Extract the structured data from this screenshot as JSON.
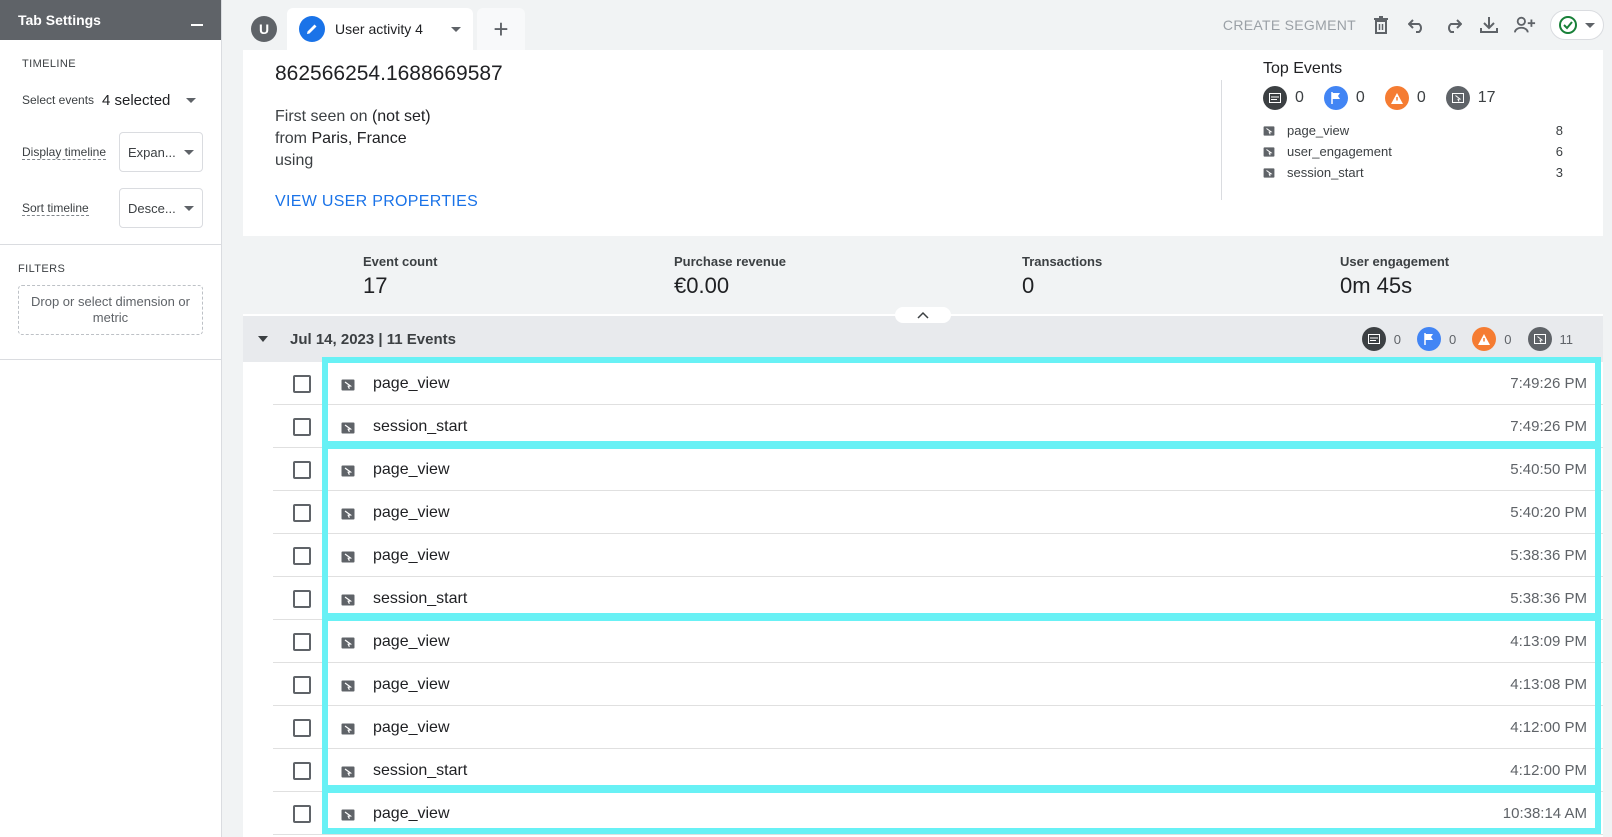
{
  "left_panel": {
    "title": "Tab Settings",
    "timeline_section": "TIMELINE",
    "select_events_label": "Select events",
    "select_events_value": "4 selected",
    "display_timeline_label": "Display timeline",
    "display_timeline_value": "Expan...",
    "sort_timeline_label": "Sort timeline",
    "sort_timeline_value": "Desce...",
    "filters_section": "FILTERS",
    "filters_drop_text": "Drop or select dimension or metric"
  },
  "topbar": {
    "avatar_letter": "U",
    "tab_label": "User activity 4",
    "create_segment": "CREATE SEGMENT"
  },
  "user": {
    "id": "862566254.1688669587",
    "first_seen_prefix": "First seen on",
    "first_seen_value": "(not set)",
    "from_prefix": "from",
    "from_value": "Paris, France",
    "using_text": "using",
    "view_properties": "VIEW USER PROPERTIES"
  },
  "top_events": {
    "title": "Top Events",
    "counts": {
      "dark": "0",
      "blue": "0",
      "orange": "0",
      "grey": "17"
    },
    "items": [
      {
        "name": "page_view",
        "value": "8"
      },
      {
        "name": "user_engagement",
        "value": "6"
      },
      {
        "name": "session_start",
        "value": "3"
      }
    ]
  },
  "metrics": [
    {
      "label": "Event count",
      "value": "17"
    },
    {
      "label": "Purchase revenue",
      "value": "€0.00"
    },
    {
      "label": "Transactions",
      "value": "0"
    },
    {
      "label": "User engagement",
      "value": "0m 45s"
    }
  ],
  "date_group": {
    "label": "Jul 14, 2023 | 11 Events",
    "counts": {
      "dark": "0",
      "blue": "0",
      "orange": "0",
      "grey": "11"
    }
  },
  "events": [
    {
      "name": "page_view",
      "time": "7:49:26 PM"
    },
    {
      "name": "session_start",
      "time": "7:49:26 PM"
    },
    {
      "name": "page_view",
      "time": "5:40:50 PM"
    },
    {
      "name": "page_view",
      "time": "5:40:20 PM"
    },
    {
      "name": "page_view",
      "time": "5:38:36 PM"
    },
    {
      "name": "session_start",
      "time": "5:38:36 PM"
    },
    {
      "name": "page_view",
      "time": "4:13:09 PM"
    },
    {
      "name": "page_view",
      "time": "4:13:08 PM"
    },
    {
      "name": "page_view",
      "time": "4:12:00 PM"
    },
    {
      "name": "session_start",
      "time": "4:12:00 PM"
    },
    {
      "name": "page_view",
      "time": "10:38:14 AM"
    }
  ],
  "colors": {
    "accent": "#1a73e8",
    "highlight": "#68f1f5"
  }
}
